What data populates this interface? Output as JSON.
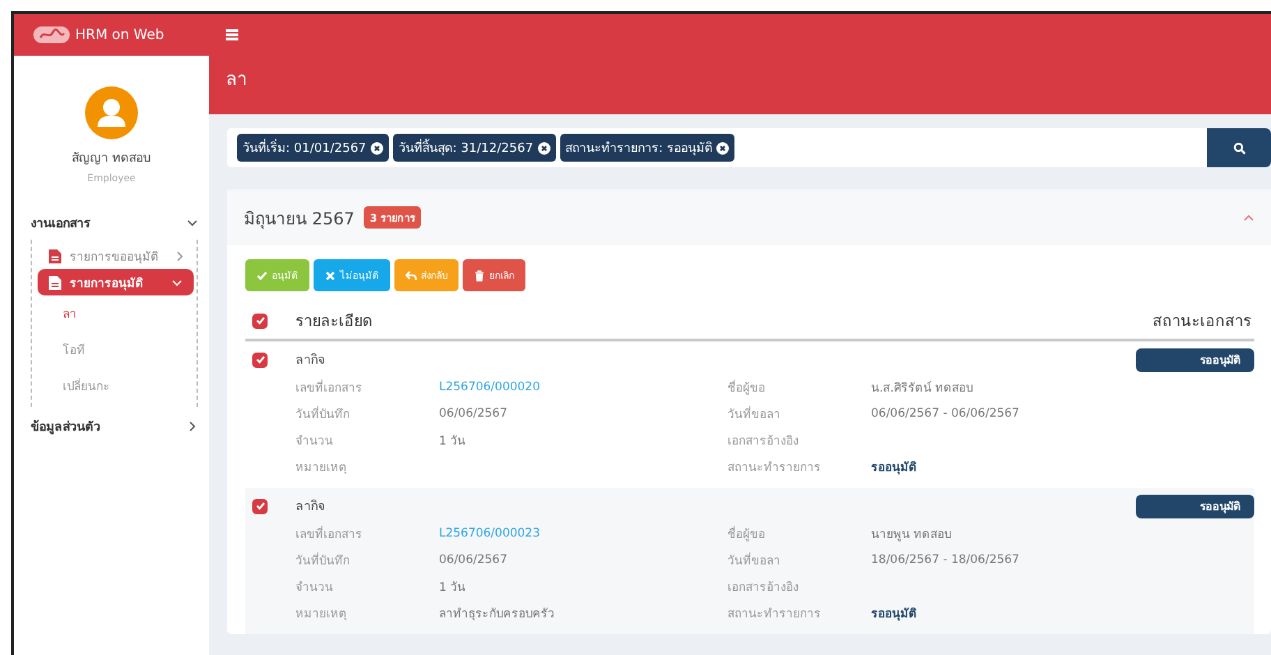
{
  "brand": {
    "title": "HRM on Web"
  },
  "user": {
    "name": "สัญญา ทดสอบ",
    "role": "Employee"
  },
  "sidebar": {
    "items": [
      {
        "label": "งานเอกสาร",
        "expanded": true,
        "children": [
          {
            "label": "รายการขออนุมัติ",
            "selected": false,
            "expanded": false
          },
          {
            "label": "รายการอนุมัติ",
            "selected": true,
            "expanded": true,
            "children": [
              {
                "label": "ลา",
                "selected": true
              },
              {
                "label": "โอที",
                "selected": false
              },
              {
                "label": "เปลี่ยนกะ",
                "selected": false
              }
            ]
          }
        ]
      },
      {
        "label": "ข้อมูลส่วนตัว",
        "expanded": false
      }
    ]
  },
  "page_title": "ลา",
  "filters": [
    "วันที่เริ่ม: 01/01/2567",
    "วันที่สิ้นสุด: 31/12/2567",
    "สถานะทำรายการ: รออนุมัติ"
  ],
  "group": {
    "title": "มิถุนายน 2567",
    "count": "3 รายการ",
    "expanded": true
  },
  "actions": [
    {
      "kind": "approve",
      "label": "อนุมัติ"
    },
    {
      "kind": "reject",
      "label": "ไม่อนุมัติ"
    },
    {
      "kind": "return",
      "label": "ส่งกลับ"
    },
    {
      "kind": "cancel",
      "label": "ยกเลิก"
    }
  ],
  "table": {
    "select_all": true,
    "columns": [
      "รายละเอียด",
      "สถานะเอกสาร"
    ],
    "rows": [
      {
        "checked": true,
        "type": "ลากิจ",
        "status": "รออนุมัติ",
        "left": [
          {
            "label": "เลขที่เอกสาร",
            "value": "L256706/000020",
            "kind": "link"
          },
          {
            "label": "วันที่บันทึก",
            "value": "06/06/2567",
            "kind": "text"
          },
          {
            "label": "จำนวน",
            "value": "1 วัน",
            "kind": "text"
          },
          {
            "label": "หมายเหตุ"
          }
        ],
        "right": [
          {
            "label": "ชื่อผู้ขอ",
            "value": "น.ส.ศิริรัตน์ ทดสอบ",
            "kind": "text"
          },
          {
            "label": "วันที่ขอลา",
            "value": "06/06/2567 - 06/06/2567",
            "kind": "text"
          },
          {
            "label": "เอกสารอ้างอิง"
          },
          {
            "label": "สถานะทำรายการ",
            "value": "รออนุมัติ",
            "kind": "bold"
          }
        ]
      },
      {
        "checked": true,
        "type": "ลากิจ",
        "status": "รออนุมัติ",
        "left": [
          {
            "label": "เลขที่เอกสาร",
            "value": "L256706/000023",
            "kind": "link"
          },
          {
            "label": "วันที่บันทึก",
            "value": "06/06/2567",
            "kind": "text"
          },
          {
            "label": "จำนวน",
            "value": "1 วัน",
            "kind": "text"
          },
          {
            "label": "หมายเหตุ",
            "value": "ลาทำธุระกับครอบครัว",
            "kind": "text"
          }
        ],
        "right": [
          {
            "label": "ชื่อผู้ขอ",
            "value": "นายพูน ทดสอบ",
            "kind": "text"
          },
          {
            "label": "วันที่ขอลา",
            "value": "18/06/2567 - 18/06/2567",
            "kind": "text"
          },
          {
            "label": "เอกสารอ้างอิง"
          },
          {
            "label": "สถานะทำรายการ",
            "value": "รออนุมัติ",
            "kind": "bold"
          }
        ]
      }
    ]
  }
}
